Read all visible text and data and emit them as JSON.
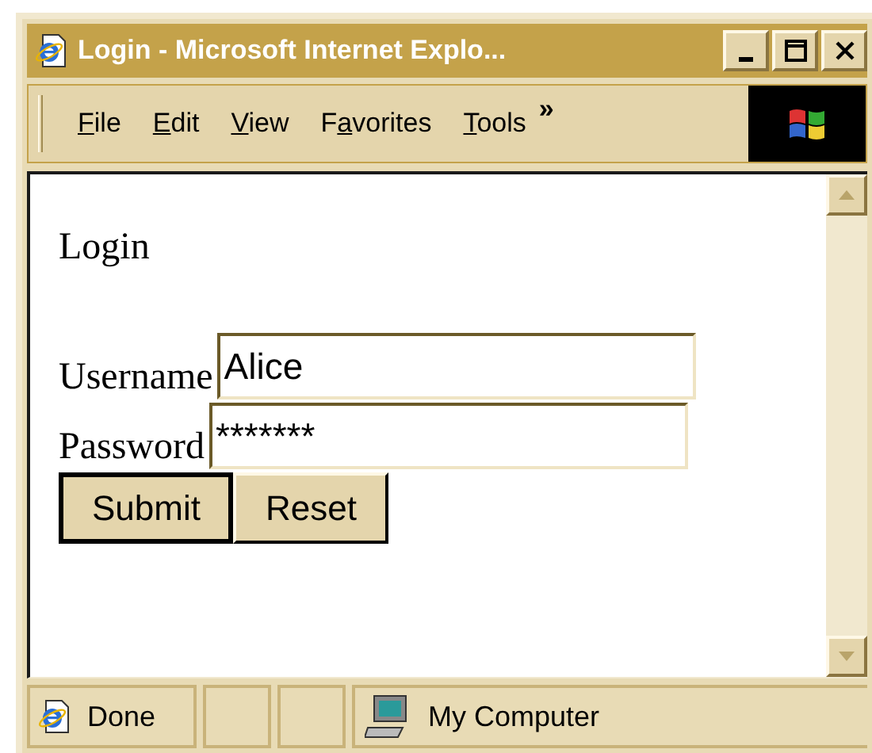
{
  "window": {
    "title": "Login - Microsoft Internet Explo..."
  },
  "menu": [
    {
      "key": "F",
      "post": "ile"
    },
    {
      "key": "E",
      "post": "dit"
    },
    {
      "key": "V",
      "post": "iew"
    },
    {
      "pre": "F",
      "key": "a",
      "post": "vorites"
    },
    {
      "key": "T",
      "post": "ools"
    }
  ],
  "menu_overflow": "»",
  "page": {
    "heading": "Login",
    "fields": [
      {
        "label": "Username",
        "value": "Alice"
      },
      {
        "label": "Password",
        "value": "*******"
      }
    ],
    "buttons": [
      {
        "label": "Submit",
        "default": true
      },
      {
        "label": "Reset",
        "default": false
      }
    ]
  },
  "status_bar": {
    "status": "Done",
    "zone": "My Computer"
  }
}
